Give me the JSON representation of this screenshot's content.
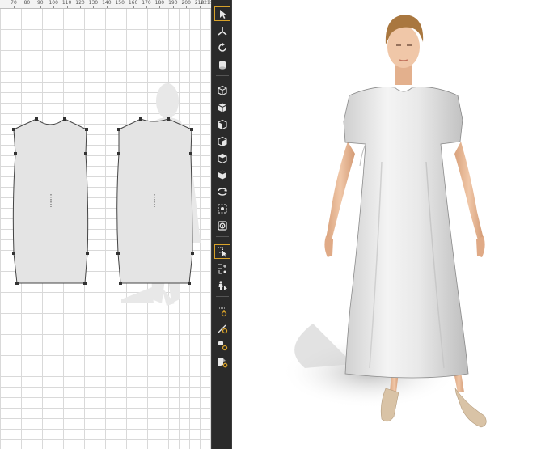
{
  "ruler": {
    "ticks": [
      "70",
      "80",
      "90",
      "100",
      "110",
      "120",
      "130",
      "140",
      "150",
      "160",
      "170",
      "180",
      "190",
      "200",
      "210",
      "220"
    ],
    "last_tick": "221"
  },
  "toolbar": {
    "tools": [
      {
        "icon": "select-pointer-icon",
        "active": true
      },
      {
        "icon": "transform-pin-icon",
        "active": false
      },
      {
        "icon": "rotate-tool-icon",
        "active": false
      },
      {
        "icon": "cylinder-icon",
        "active": false
      },
      {
        "icon": "view-cube-front-icon",
        "active": false
      },
      {
        "icon": "view-cube-back-icon",
        "active": false
      },
      {
        "icon": "view-cube-left-icon",
        "active": false
      },
      {
        "icon": "view-cube-right-icon",
        "active": false
      },
      {
        "icon": "view-cube-top-icon",
        "active": false
      },
      {
        "icon": "view-cube-bottom-icon",
        "active": false
      },
      {
        "icon": "reset-rotation-icon",
        "active": false
      },
      {
        "icon": "zoom-fit-icon",
        "active": false
      },
      {
        "icon": "camera-target-icon",
        "active": false
      },
      {
        "icon": "select-garment-icon",
        "active": true
      },
      {
        "icon": "arrangement-points-icon",
        "active": false
      },
      {
        "icon": "avatar-select-icon",
        "active": false
      },
      {
        "icon": "pin-tool-icon",
        "active": false
      },
      {
        "icon": "edit-line-tool-icon",
        "active": false
      },
      {
        "icon": "tack-tool-icon",
        "active": false
      },
      {
        "icon": "fold-tool-icon",
        "active": false
      }
    ]
  },
  "colors": {
    "panel_fill": "#e4e4e4",
    "panel_stroke": "#444444",
    "toolbar_bg": "#2a2a2a",
    "active_border": "#d8a22a",
    "dress": "#ececec",
    "skin": "#e8b896",
    "hair": "#a9773f",
    "shoe": "#d9c3a6"
  }
}
